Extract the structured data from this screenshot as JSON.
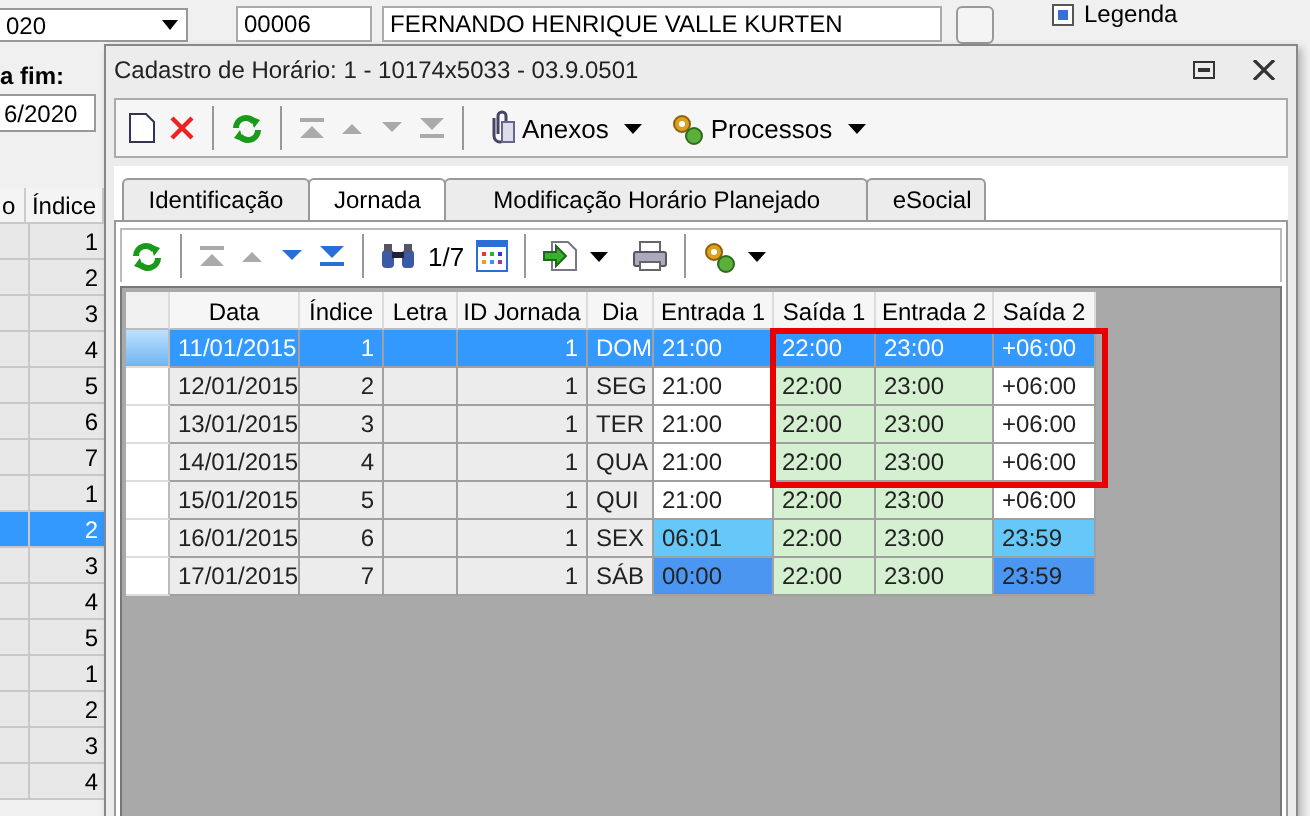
{
  "background_window": {
    "period_select": "020",
    "end_date_label": "a fim:",
    "end_date": "6/2020",
    "employee_code": "00006",
    "employee_name": "FERNANDO HENRIQUE VALLE KURTEN",
    "legend": {
      "label": "Legenda",
      "checked": true
    },
    "table": {
      "columns": [
        "o",
        "Índice"
      ],
      "rows": [
        {
          "index": "1",
          "selected": false
        },
        {
          "index": "2",
          "selected": false
        },
        {
          "index": "3",
          "selected": false
        },
        {
          "index": "4",
          "selected": false
        },
        {
          "index": "5",
          "selected": false
        },
        {
          "index": "6",
          "selected": false
        },
        {
          "index": "7",
          "selected": false
        },
        {
          "index": "1",
          "selected": false
        },
        {
          "index": "2",
          "selected": true
        },
        {
          "index": "3",
          "selected": false
        },
        {
          "index": "4",
          "selected": false
        },
        {
          "index": "5",
          "selected": false
        },
        {
          "index": "1",
          "selected": false
        },
        {
          "index": "2",
          "selected": false
        },
        {
          "index": "3",
          "selected": false
        },
        {
          "index": "4",
          "selected": false
        }
      ]
    }
  },
  "dialog": {
    "title": "Cadastro de Horário: 1 - 10174x5033 - 03.9.0501",
    "toolbar": {
      "attachments": "Anexos",
      "processes": "Processos"
    },
    "tabs": [
      {
        "label": "Identificação",
        "selected": false
      },
      {
        "label": "Jornada",
        "selected": true
      },
      {
        "label": "Modificação Horário Planejado",
        "selected": false
      },
      {
        "label": "eSocial",
        "selected": false
      }
    ],
    "grid_toolbar": {
      "record_counter": "1/7"
    },
    "grid": {
      "columns": [
        "Data",
        "Índice",
        "Letra",
        "ID Jornada",
        "Dia",
        "Entrada 1",
        "Saída 1",
        "Entrada 2",
        "Saída 2"
      ],
      "rows": [
        {
          "date": "11/01/2015",
          "index": "1",
          "shift_id": "1",
          "day": "DOM",
          "selected": true,
          "highlighted": true,
          "times": [
            {
              "text": "21:00",
              "color": "#3399ff"
            },
            {
              "text": "22:00",
              "color": "#3399ff"
            },
            {
              "text": "23:00",
              "color": "#3399ff"
            },
            {
              "text": "+06:00",
              "color": "#3399ff"
            }
          ]
        },
        {
          "date": "12/01/2015",
          "index": "2",
          "shift_id": "1",
          "day": "SEG",
          "selected": false,
          "highlighted": true,
          "times": [
            {
              "text": "21:00",
              "color": "#ffffff"
            },
            {
              "text": "22:00",
              "color": "#d4f0d0"
            },
            {
              "text": "23:00",
              "color": "#d4f0d0"
            },
            {
              "text": "+06:00",
              "color": "#ffffff"
            }
          ]
        },
        {
          "date": "13/01/2015",
          "index": "3",
          "shift_id": "1",
          "day": "TER",
          "selected": false,
          "highlighted": true,
          "times": [
            {
              "text": "21:00",
              "color": "#ffffff"
            },
            {
              "text": "22:00",
              "color": "#d4f0d0"
            },
            {
              "text": "23:00",
              "color": "#d4f0d0"
            },
            {
              "text": "+06:00",
              "color": "#ffffff"
            }
          ]
        },
        {
          "date": "14/01/2015",
          "index": "4",
          "shift_id": "1",
          "day": "QUA",
          "selected": false,
          "highlighted": true,
          "times": [
            {
              "text": "21:00",
              "color": "#ffffff"
            },
            {
              "text": "22:00",
              "color": "#d4f0d0"
            },
            {
              "text": "23:00",
              "color": "#d4f0d0"
            },
            {
              "text": "+06:00",
              "color": "#ffffff"
            }
          ]
        },
        {
          "date": "15/01/2015",
          "index": "5",
          "shift_id": "1",
          "day": "QUI",
          "selected": false,
          "highlighted": false,
          "times": [
            {
              "text": "21:00",
              "color": "#ffffff"
            },
            {
              "text": "22:00",
              "color": "#d4f0d0"
            },
            {
              "text": "23:00",
              "color": "#d4f0d0"
            },
            {
              "text": "+06:00",
              "color": "#ffffff"
            }
          ]
        },
        {
          "date": "16/01/2015",
          "index": "6",
          "shift_id": "1",
          "day": "SEX",
          "selected": false,
          "highlighted": false,
          "times": [
            {
              "text": "06:01",
              "color": "#66c8f8"
            },
            {
              "text": "22:00",
              "color": "#d4f0d0"
            },
            {
              "text": "23:00",
              "color": "#d4f0d0"
            },
            {
              "text": "23:59",
              "color": "#66c8f8"
            }
          ]
        },
        {
          "date": "17/01/2015",
          "index": "7",
          "shift_id": "1",
          "day": "SÁB",
          "selected": false,
          "highlighted": false,
          "times": [
            {
              "text": "00:00",
              "color": "#4a96f0"
            },
            {
              "text": "22:00",
              "color": "#d4f0d0"
            },
            {
              "text": "23:00",
              "color": "#d4f0d0"
            },
            {
              "text": "23:59",
              "color": "#4a96f0"
            }
          ]
        }
      ]
    }
  }
}
